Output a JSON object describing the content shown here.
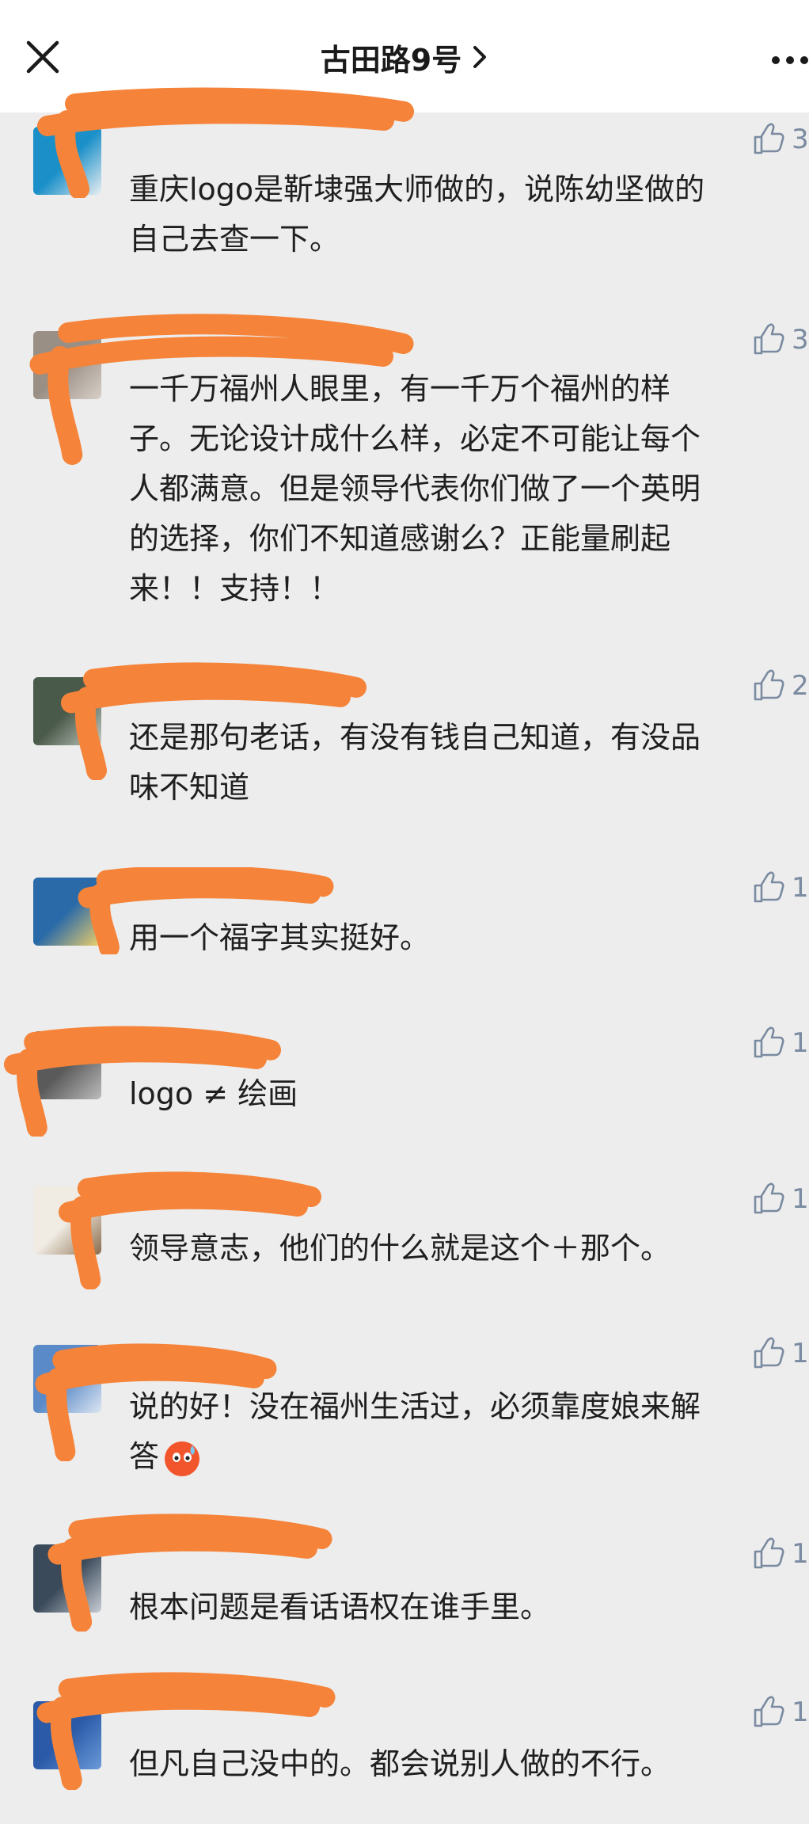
{
  "header": {
    "title": "古田路9号",
    "close_icon": "close-icon",
    "chevron_icon": "chevron-right-icon",
    "more_icon": "more-icon"
  },
  "colors": {
    "scribble": "#f5843a",
    "like_icon": "#7a8aa0",
    "background": "#ededed"
  },
  "comments": [
    {
      "lines": [
        "重庆logo是靳埭强大师做的，说陈幼坚做的",
        "自己去查一下。"
      ],
      "likes": "3"
    },
    {
      "lines": [
        "一千万福州人眼里，有一千万个福州的样",
        "子。无论设计成什么样，必定不可能让每个",
        "人都满意。但是领导代表你们做了一个英明",
        "的选择，你们不知道感谢么？正能量刷起",
        "来！！支持！！"
      ],
      "likes": "3"
    },
    {
      "lines": [
        "还是那句老话，有没有钱自己知道，有没品",
        "味不知道"
      ],
      "likes": "2"
    },
    {
      "lines": [
        "用一个福字其实挺好。"
      ],
      "likes": "1"
    },
    {
      "lines": [
        "logo ≠ 绘画"
      ],
      "likes": "1"
    },
    {
      "lines": [
        "领导意志，他们的什么就是这个＋那个。"
      ],
      "likes": "1"
    },
    {
      "lines": [
        "说的好！没在福州生活过，必须靠度娘来解",
        "答"
      ],
      "likes": "1",
      "emoji": "hot-face-emoji"
    },
    {
      "lines": [
        "根本问题是看话语权在谁手里。"
      ],
      "likes": "1"
    },
    {
      "lines": [
        "但凡自己没中的。都会说别人做的不行。"
      ],
      "likes": "1"
    }
  ]
}
